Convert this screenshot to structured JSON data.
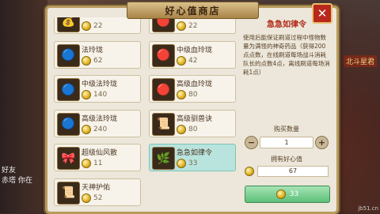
{
  "window": {
    "title": "好心值商店"
  },
  "items": [
    {
      "name": "",
      "price": "22",
      "icon": "coin-pouch-icon",
      "selected": false
    },
    {
      "name": "",
      "price": "22",
      "icon": "red-orb-icon",
      "selected": false
    },
    {
      "name": "法玲珑",
      "price": "62",
      "icon": "blue-orb-icon",
      "selected": false
    },
    {
      "name": "中级血玲珑",
      "price": "42",
      "icon": "red-orb-icon",
      "selected": false
    },
    {
      "name": "中级法玲珑",
      "price": "140",
      "icon": "blue-orb-icon",
      "selected": false
    },
    {
      "name": "高级血玲珑",
      "price": "80",
      "icon": "red-orb-icon",
      "selected": false
    },
    {
      "name": "高级法玲珑",
      "price": "240",
      "icon": "blue-orb-icon",
      "selected": false
    },
    {
      "name": "高级驯兽诀",
      "price": "80",
      "icon": "scroll-icon",
      "selected": false
    },
    {
      "name": "超级仙风散",
      "price": "11",
      "icon": "pink-potion-icon",
      "selected": false
    },
    {
      "name": "急急如律令",
      "price": "33",
      "icon": "talisman-icon",
      "selected": true
    },
    {
      "name": "天神护佑",
      "price": "52",
      "icon": "scroll-icon",
      "selected": false
    }
  ],
  "detail": {
    "name": "急急如律令",
    "description": "使用后能保证刷道过程中怪物数量为满怪的神奇药品（获得200点点数，在线刷道每场战斗消耗队长的点数4点，离线刷道每场消耗1点）",
    "quantity_label": "购买数量",
    "quantity": "1",
    "minus": "−",
    "plus": "+",
    "owned_label": "拥有好心值",
    "owned_value": "67",
    "buy_price": "33"
  },
  "background": {
    "sign_text": "北斗星君",
    "chat_name": "好友",
    "chat_text": "赤塔 你在",
    "watermark": "jb51.cn"
  },
  "colors": {
    "accent": "#b02818",
    "buy": "#5cbf78",
    "selected": "#b9e4de"
  }
}
